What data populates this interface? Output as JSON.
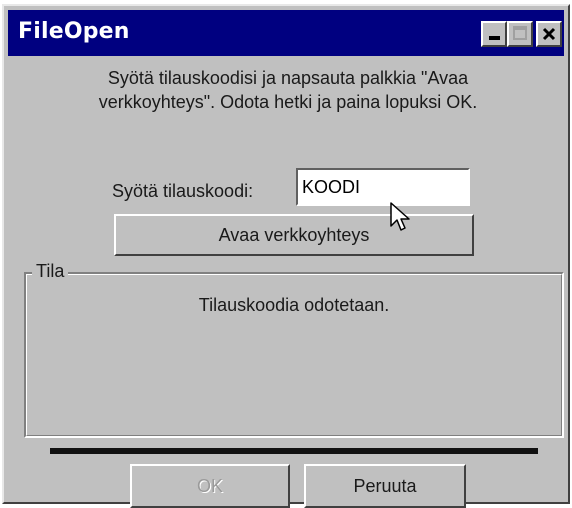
{
  "window": {
    "title": "FileOpen"
  },
  "instructions": {
    "line1": "Syötä tilauskoodisi ja napsauta palkkia \"Avaa",
    "line2": "verkkoyhteys\". Odota hetki ja paina lopuksi OK."
  },
  "code": {
    "label": "Syötä tilauskoodi:",
    "value": "KOODI"
  },
  "buttons": {
    "connect": "Avaa verkkoyhteys",
    "ok": "OK",
    "cancel": "Peruuta"
  },
  "status_group": {
    "legend": "Tila",
    "message": "Tilauskoodia odotetaan."
  },
  "icons": {
    "minimize": "minimize-icon",
    "maximize": "maximize-icon",
    "close": "close-icon",
    "cursor": "mouse-pointer-icon"
  },
  "colors": {
    "titlebar": "#000080",
    "face": "#c0c0c0",
    "disabled_text": "#9a9a9a"
  }
}
